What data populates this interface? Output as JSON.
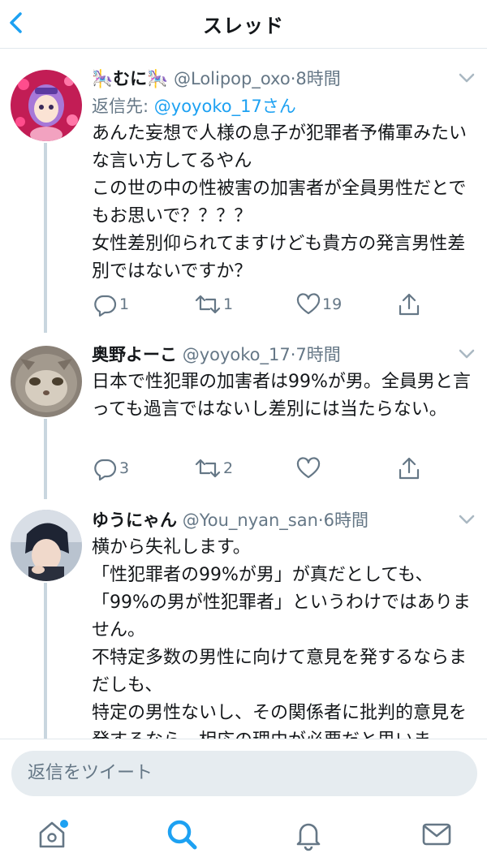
{
  "header": {
    "title": "スレッド"
  },
  "tweets": [
    {
      "name": "🎠むに🎠",
      "handle": "@Lolipop_oxo",
      "time": "8時間",
      "reply_prefix": "返信先: ",
      "reply_mention": "@yoyoko_17さん",
      "text": "あんた妄想で人様の息子が犯罪者予備軍みたいな言い方してるやん\nこの世の中の性被害の加害者が全員男性だとでもお思いで？？？？\n女性差別仰られてますけども貴方の発言男性差別ではないですか？",
      "replies": "1",
      "retweets": "1",
      "likes": "19"
    },
    {
      "name": "奥野よーこ",
      "handle": "@yoyoko_17",
      "time": "7時間",
      "text": "日本で性犯罪の加害者は99%が男。全員男と言っても過言ではないし差別には当たらない。",
      "replies": "3",
      "retweets": "2",
      "likes": ""
    },
    {
      "name": "ゆうにゃん",
      "handle": "@You_nyan_san",
      "time": "6時間",
      "text": "横から失礼します。\n「性犯罪者の99%が男」が真だとしても、\n「99%の男が性犯罪者」というわけではありません。\n不特定多数の男性に向けて意見を発するならまだしも、\n特定の男性ないし、その関係者に批判的意見を発するなら、相応の理由が必要だと思いま"
    }
  ],
  "composer": {
    "placeholder": "返信をツイート"
  },
  "colors": {
    "accent": "#1da1f2",
    "muted": "#657786",
    "thread_line": "#c9d6df"
  },
  "icons": [
    "back-arrow-icon",
    "chevron-down-icon",
    "reply-icon",
    "retweet-icon",
    "like-icon",
    "share-icon",
    "home-icon",
    "search-icon",
    "notifications-icon",
    "messages-icon"
  ]
}
